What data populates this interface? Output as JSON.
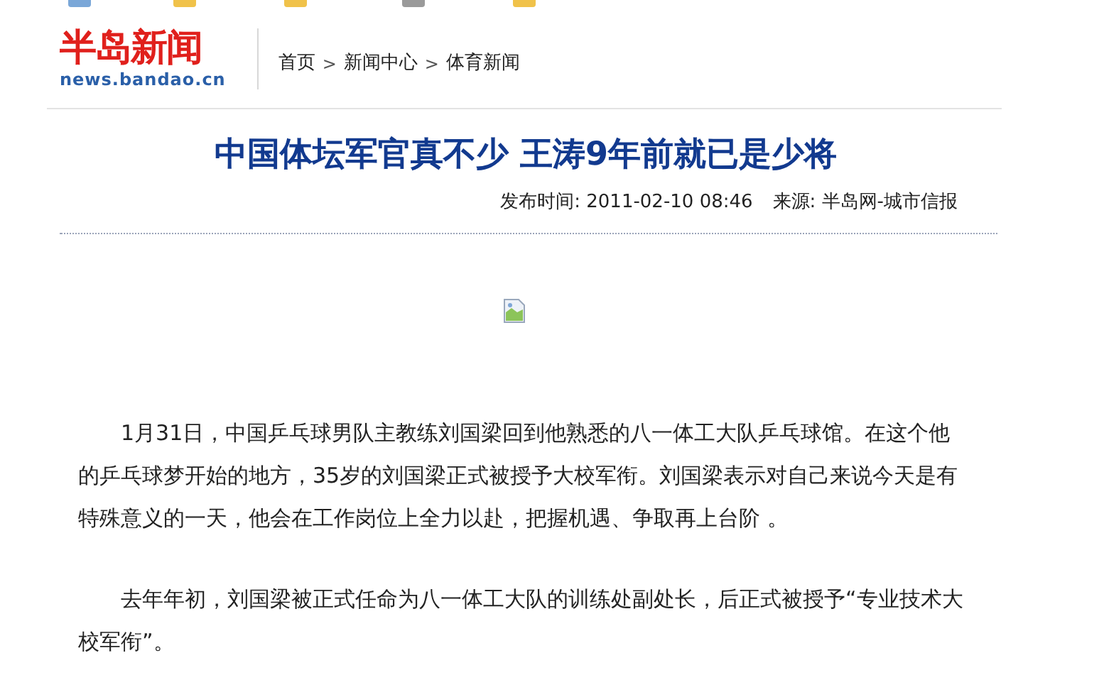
{
  "top_icons": [
    {
      "color": "#7aa7d8"
    },
    {
      "color": "#f0c24a"
    },
    {
      "color": "#f0c24a"
    },
    {
      "color": "#9a9a9a"
    },
    {
      "color": "#f0c24a"
    }
  ],
  "logo": {
    "name": "半岛新闻",
    "domain": "news.bandao.cn"
  },
  "breadcrumb": [
    {
      "kind": "link",
      "label": "首页"
    },
    {
      "kind": "separator",
      "label": ">"
    },
    {
      "kind": "link",
      "label": "新闻中心"
    },
    {
      "kind": "separator",
      "label": ">"
    },
    {
      "kind": "link",
      "label": "体育新闻"
    }
  ],
  "article": {
    "title": "中国体坛军官真不少 王涛9年前就已是少将",
    "published": "发布时间: 2011-02-10 08:46",
    "source": "来源: 半岛网-城市信报",
    "image": {
      "kind": "broken"
    },
    "paragraphs": [
      "1月31日，中国乒乓球男队主教练刘国梁回到他熟悉的八一体工大队乒乓球馆。在这个他的乒乓球梦开始的地方，35岁的刘国梁正式被授予大校军衔。刘国梁表示对自己来说今天是有特殊意义的一天，他会在工作岗位上全力以赴，把握机遇、争取再上台阶 。",
      "去年年初，刘国梁被正式任命为八一体工大队的训练处副处长，后正式被授予“专业技术大校军衔”。"
    ]
  }
}
